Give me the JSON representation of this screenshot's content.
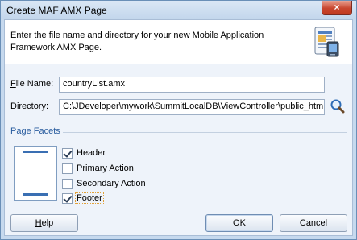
{
  "window": {
    "title": "Create MAF AMX Page",
    "close_label": "×"
  },
  "header": {
    "description": "Enter the file name and directory for your new Mobile Application Framework AMX Page.",
    "icon": "mobile-page-icon"
  },
  "form": {
    "file_name": {
      "label_hot": "F",
      "label_rest": "ile Name:",
      "value": "countryList.amx"
    },
    "directory": {
      "label_hot": "D",
      "label_rest": "irectory:",
      "value": "C:\\JDeveloper\\mywork\\SummitLocalDB\\ViewController\\public_html",
      "browse_icon": "magnifier-icon"
    }
  },
  "facets": {
    "title": "Page Facets",
    "items": [
      {
        "label": "Header",
        "checked": true
      },
      {
        "label": "Primary Action",
        "checked": false
      },
      {
        "label": "Secondary Action",
        "checked": false
      },
      {
        "label": "Footer",
        "checked": true
      }
    ]
  },
  "buttons": {
    "help_hot": "H",
    "help_rest": "elp",
    "ok": "OK",
    "cancel": "Cancel"
  },
  "colors": {
    "accent": "#2a5d9f",
    "frame": "#c6d9ee",
    "close": "#c8462f"
  }
}
